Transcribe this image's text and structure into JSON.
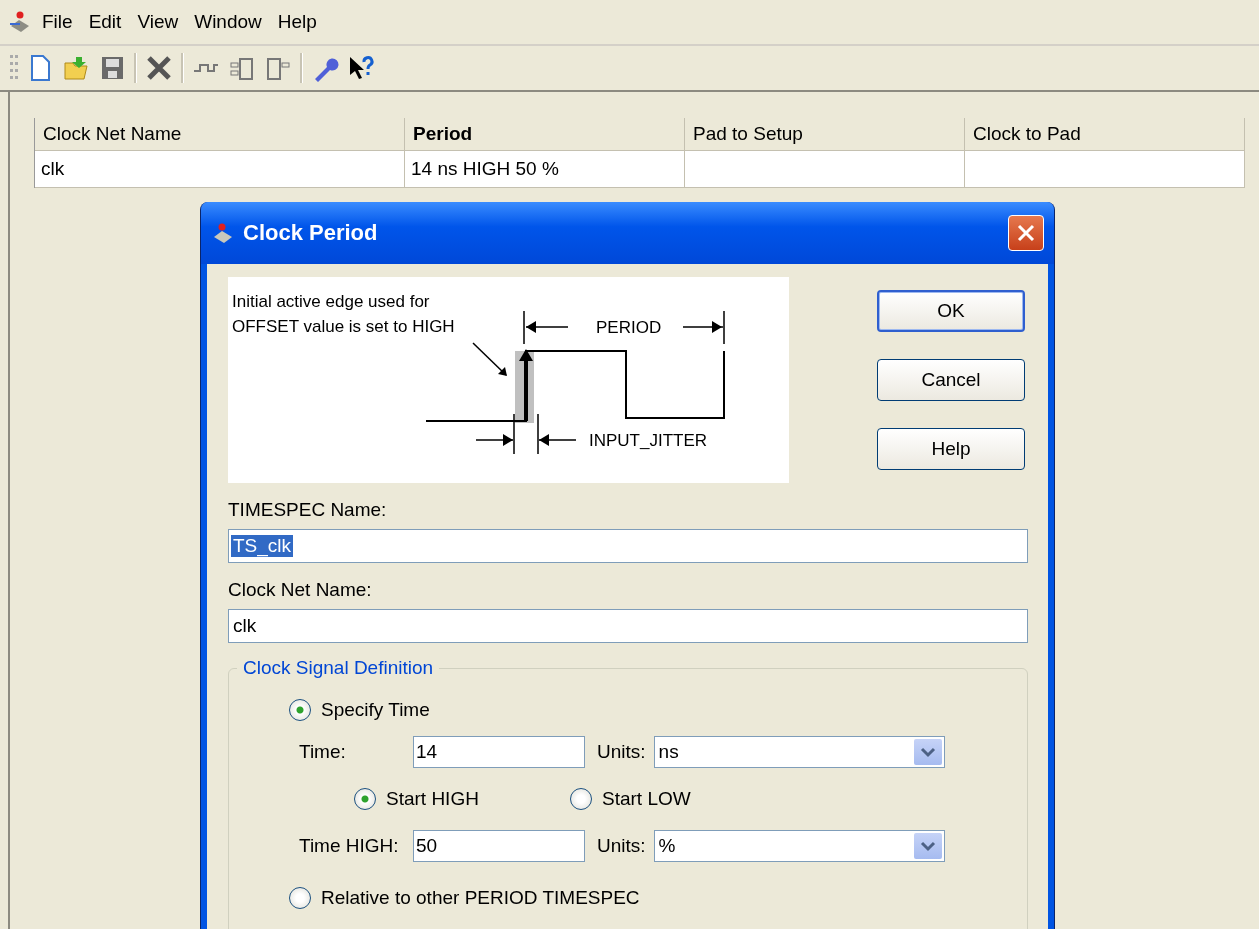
{
  "menu": [
    "File",
    "Edit",
    "View",
    "Window",
    "Help"
  ],
  "table": {
    "columns": [
      {
        "label": "Clock Net Name",
        "bold": false
      },
      {
        "label": "Period",
        "bold": true
      },
      {
        "label": "Pad to Setup",
        "bold": false
      },
      {
        "label": "Clock to Pad",
        "bold": false
      }
    ],
    "rows": [
      {
        "cells": [
          "clk",
          "14 ns HIGH 50 %"
        ]
      }
    ]
  },
  "dialog": {
    "title": "Clock Period",
    "diagram": {
      "note_lines": [
        "Initial active edge used for",
        "OFFSET value is set to HIGH"
      ],
      "period_label": "PERIOD",
      "jitter_label": "INPUT_JITTER"
    },
    "buttons": [
      {
        "label": "OK",
        "default": true
      },
      {
        "label": "Cancel",
        "default": false
      },
      {
        "label": "Help",
        "default": false
      }
    ],
    "timespec": {
      "label": "TIMESPEC Name:",
      "value": "TS_clk",
      "text_selected": true
    },
    "net": {
      "label": "Clock Net Name:",
      "value": "clk",
      "text_selected": false
    },
    "group": {
      "title": "Clock Signal Definition",
      "modes": [
        {
          "label": "Specify Time",
          "selected": true
        },
        {
          "label": "Relative to other PERIOD TIMESPEC",
          "selected": false
        }
      ],
      "time": {
        "label": "Time:",
        "value": "14",
        "units_label": "Units:",
        "units": "ns"
      },
      "start": [
        {
          "label": "Start HIGH",
          "selected": true
        },
        {
          "label": "Start LOW",
          "selected": false
        }
      ],
      "time_high": {
        "label": "Time HIGH:",
        "value": "50",
        "units_label": "Units:",
        "units": "%"
      }
    }
  }
}
